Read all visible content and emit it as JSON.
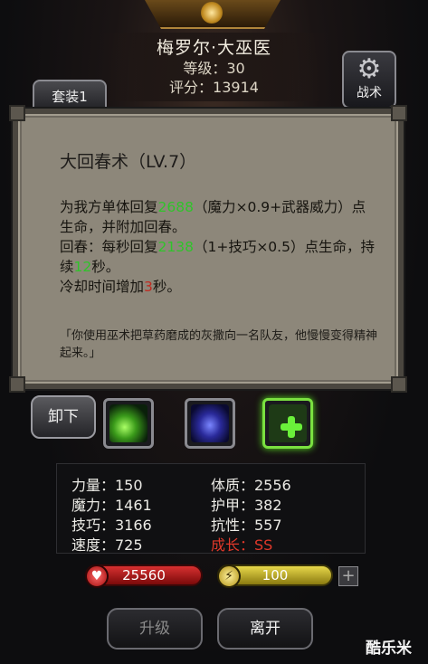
{
  "header": {
    "name": "梅罗尔·大巫医",
    "level": "等级：30",
    "score": "评分：13914"
  },
  "suit_tab": "套装1",
  "tactic": {
    "label": "战术",
    "icon": "gear-icon"
  },
  "tooltip": {
    "title": "大回春术（LV.7）",
    "desc": {
      "p1a": "为我方单体回复",
      "p1_val": "2688",
      "p1b": "（魔力×0.9+武器威力）点生命，并附加回春。",
      "p2a": "回春：每秒回复",
      "p2_val": "2138",
      "p2b": "（1+技巧×0.5）点生命，持续",
      "p2_dur": "12",
      "p2c": "秒。",
      "p3a": "冷却时间增加",
      "p3_val": "3",
      "p3b": "秒。"
    },
    "flavor": "「你使用巫术把草药磨成的灰撒向一名队友，他慢慢变得精神起来。」"
  },
  "unequip": "卸下",
  "skills": [
    {
      "icon": "green-spirit-skill-icon"
    },
    {
      "icon": "blue-demon-skill-icon"
    },
    {
      "icon": "heal-cross-skill-icon",
      "selected": true
    }
  ],
  "stats": {
    "strength": "力量：150",
    "magic": "魔力：1461",
    "skill": "技巧：3166",
    "speed": "速度：725",
    "constitution": "体质：2556",
    "armor": "护甲：382",
    "resistance": "抗性：557",
    "growth": "成长：SS"
  },
  "hp": "25560",
  "energy": "100",
  "buttons": {
    "upgrade": "升级",
    "leave": "离开"
  },
  "watermark": "酷乐米",
  "colors": {
    "value_green": "#2fc42a",
    "value_red": "#c02a20",
    "growth_red": "#e0382a"
  }
}
